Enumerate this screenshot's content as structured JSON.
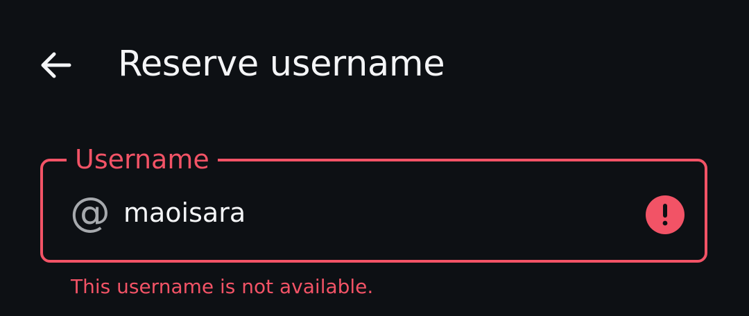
{
  "header": {
    "title": "Reserve username",
    "back_icon": "arrow-left-icon"
  },
  "username_field": {
    "label": "Username",
    "prefix_icon": "at-sign-icon",
    "prefix_symbol": "@",
    "value": "maoisara",
    "state": "error",
    "error_icon": "alert-circle-icon",
    "error_message": "This username is not available."
  },
  "colors": {
    "background": "#0d1014",
    "text_primary": "#f4f5f7",
    "error": "#f25366",
    "icon_muted": "#a6a9ad"
  }
}
